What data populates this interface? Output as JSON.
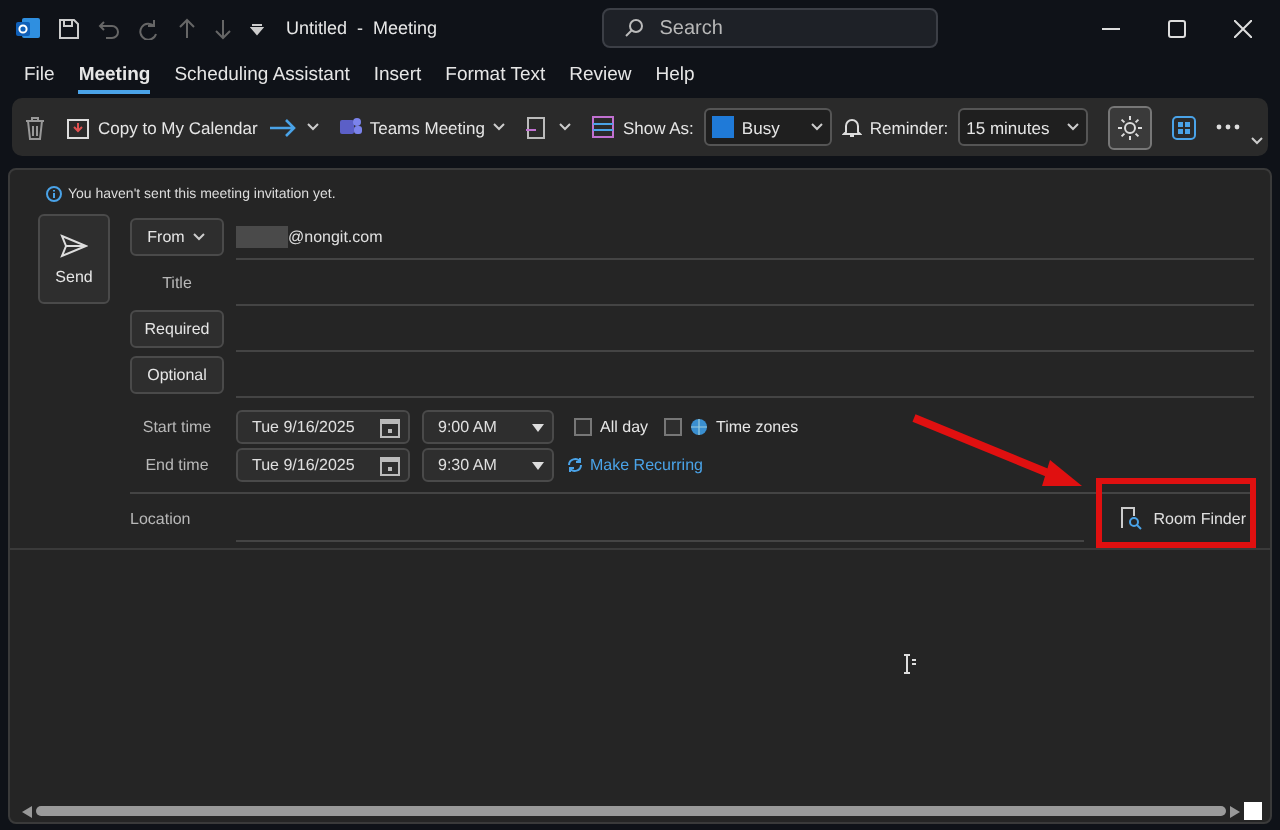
{
  "window": {
    "title": "Untitled  -  Meeting"
  },
  "search": {
    "placeholder": "Search"
  },
  "tabs": [
    {
      "label": "File",
      "selected": false
    },
    {
      "label": "Meeting",
      "selected": true
    },
    {
      "label": "Scheduling Assistant",
      "selected": false
    },
    {
      "label": "Insert",
      "selected": false
    },
    {
      "label": "Format Text",
      "selected": false
    },
    {
      "label": "Review",
      "selected": false
    },
    {
      "label": "Help",
      "selected": false
    }
  ],
  "ribbon": {
    "copy_to_calendar": "Copy to My Calendar",
    "teams_meeting": "Teams Meeting",
    "show_as_label": "Show As:",
    "show_as_value": "Busy",
    "reminder_label": "Reminder:",
    "reminder_value": "15 minutes",
    "dark_mode_on": true
  },
  "info": "You haven't sent this meeting invitation yet.",
  "send": "Send",
  "from": {
    "label": "From",
    "value": "@nongit.com"
  },
  "title_label": "Title",
  "required": "Required",
  "optional": "Optional",
  "start": {
    "label": "Start time",
    "date": "Tue 9/16/2025",
    "time": "9:00 AM"
  },
  "end": {
    "label": "End time",
    "date": "Tue 9/16/2025",
    "time": "9:30 AM"
  },
  "options": [
    {
      "label": "All day",
      "checked": false,
      "kind": "plain"
    },
    {
      "label": "Time zones",
      "checked": false,
      "kind": "globe"
    }
  ],
  "make_recurring": "Make Recurring",
  "location_label": "Location",
  "room_finder": "Room Finder"
}
